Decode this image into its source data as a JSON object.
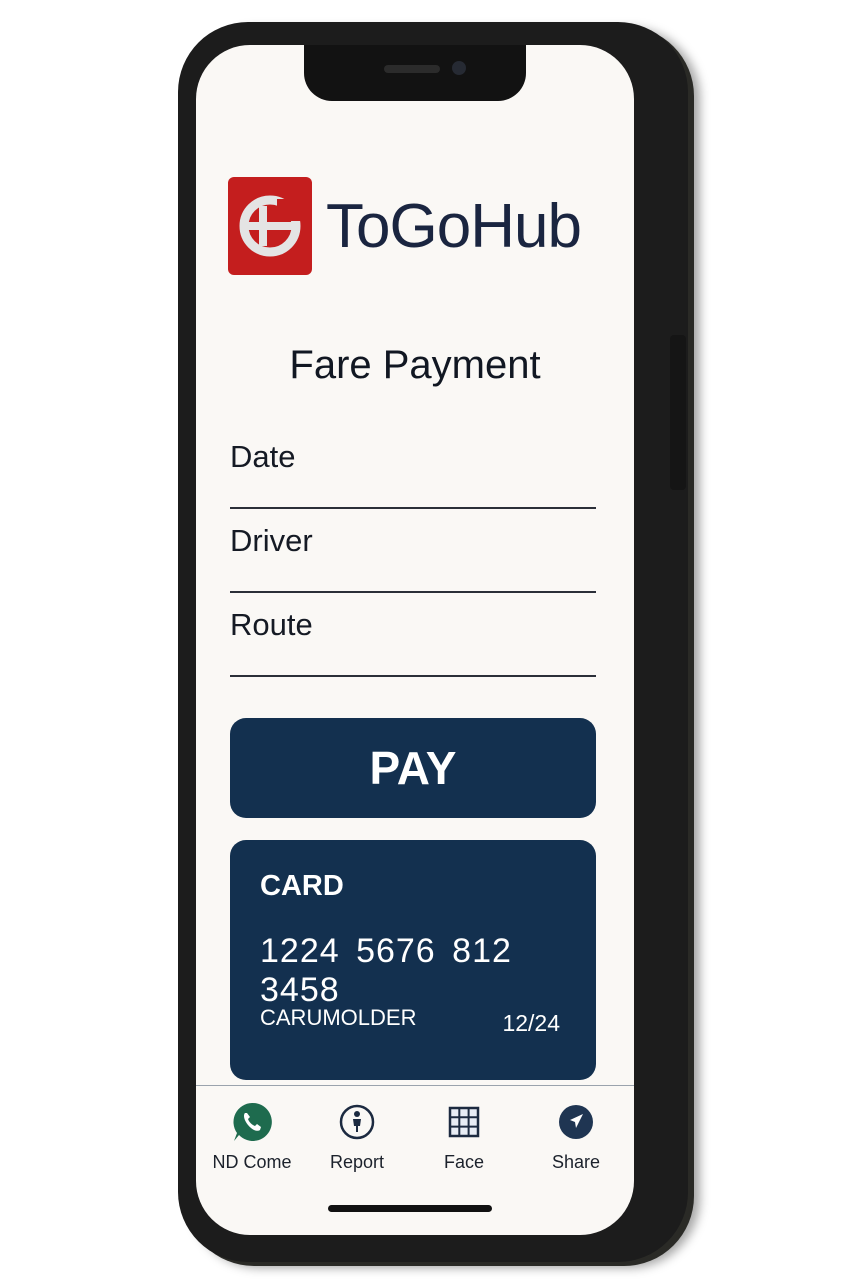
{
  "app": {
    "brand_name": "ToGoHub",
    "logo_icon": "togohub-logo-icon",
    "brand_color": "#c41e1e"
  },
  "page": {
    "title": "Fare Payment"
  },
  "form": {
    "fields": [
      {
        "label": "Date"
      },
      {
        "label": "Driver"
      },
      {
        "label": "Route"
      }
    ]
  },
  "pay_button": {
    "label": "PAY",
    "color": "#13304f"
  },
  "card": {
    "title": "CARD",
    "number": "1224 5676 812 3458",
    "holder": "CARUMOLDER",
    "expiry": "12/24"
  },
  "tabbar": {
    "items": [
      {
        "label": "ND Come",
        "icon": "phone-chat-icon"
      },
      {
        "label": "Report",
        "icon": "person-icon"
      },
      {
        "label": "Face",
        "icon": "grid-icon"
      },
      {
        "label": "Share",
        "icon": "navigation-arrow-icon"
      }
    ]
  }
}
